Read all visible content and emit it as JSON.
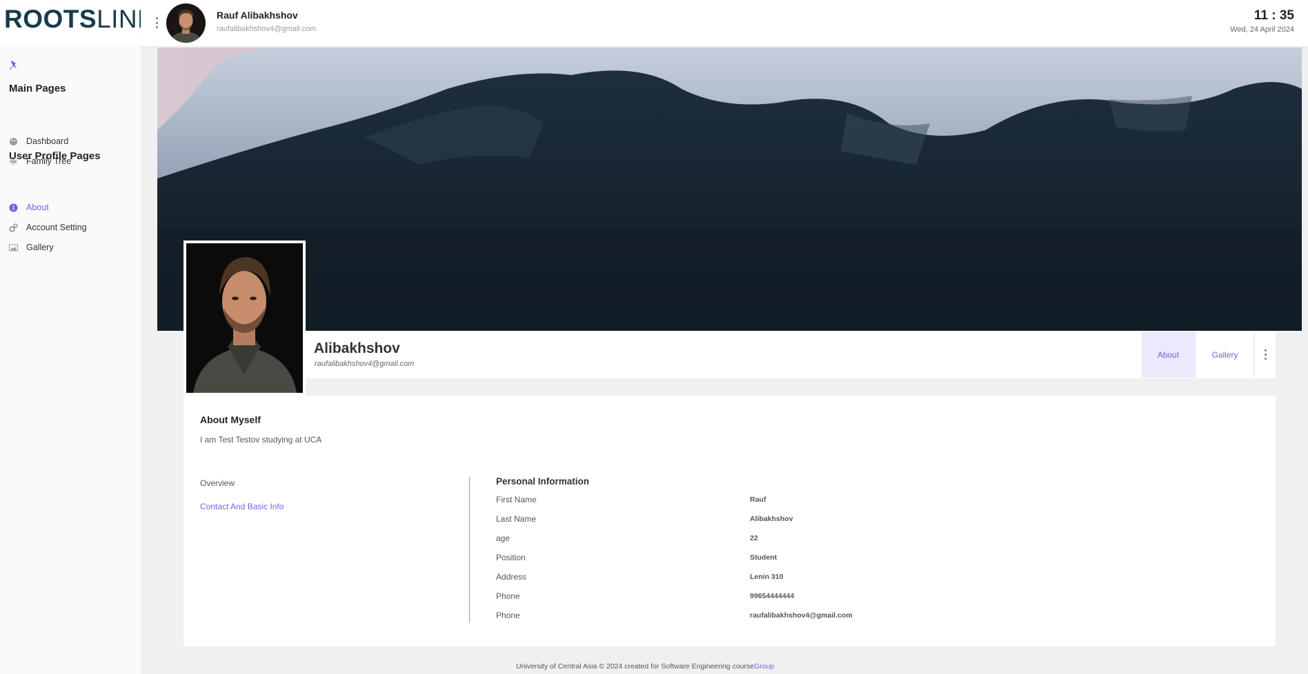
{
  "brand": {
    "logo_bold": "ROOTS",
    "logo_light": "LINK"
  },
  "user": {
    "name": "Rauf Alibakhshov",
    "email": "raufalibakhshov4@gmail.com"
  },
  "clock": {
    "time": "11 : 35",
    "date": "Wed, 24 April 2024"
  },
  "sidebar": {
    "pin_icon": "pin-icon",
    "sections": [
      {
        "title": "Main Pages"
      },
      {
        "title": "User Profile Pages"
      }
    ],
    "items": [
      {
        "label": "Dashboard",
        "icon": "palette-icon"
      },
      {
        "label": "Family Tree",
        "icon": "tree-icon"
      },
      {
        "label": "About",
        "icon": "info-icon",
        "active": true
      },
      {
        "label": "Account Setting",
        "icon": "gears-icon"
      },
      {
        "label": "Gallery",
        "icon": "image-icon"
      }
    ]
  },
  "profile": {
    "name": "Alibakhshov",
    "email": "raufalibakhshov4@gmail.com",
    "tabs": [
      {
        "label": "About",
        "active": true
      },
      {
        "label": "Gallery"
      }
    ]
  },
  "about": {
    "title": "About Myself",
    "text": "I am Test Testov studying at UCA",
    "links": [
      "Overview",
      "Contact And Basic Info"
    ]
  },
  "personal_info": {
    "title": "Personal Information",
    "rows": [
      {
        "label": "First Name",
        "value": "Rauf"
      },
      {
        "label": "Last Name",
        "value": "Alibakhshov"
      },
      {
        "label": "age",
        "value": "22"
      },
      {
        "label": "Position",
        "value": "Student"
      },
      {
        "label": "Address",
        "value": "Lenin 310"
      },
      {
        "label": "Phone",
        "value": "99654444444"
      },
      {
        "label": "Phone",
        "value": "raufalibakhshov4@gmail.com"
      }
    ]
  },
  "footer": {
    "text": "University of Central Asia © 2024 created for Software Engineering course",
    "link": "Group"
  },
  "colors": {
    "accent": "#6e64e6",
    "logo": "#173c4a",
    "active_tab_bg": "#ebe9fb"
  }
}
